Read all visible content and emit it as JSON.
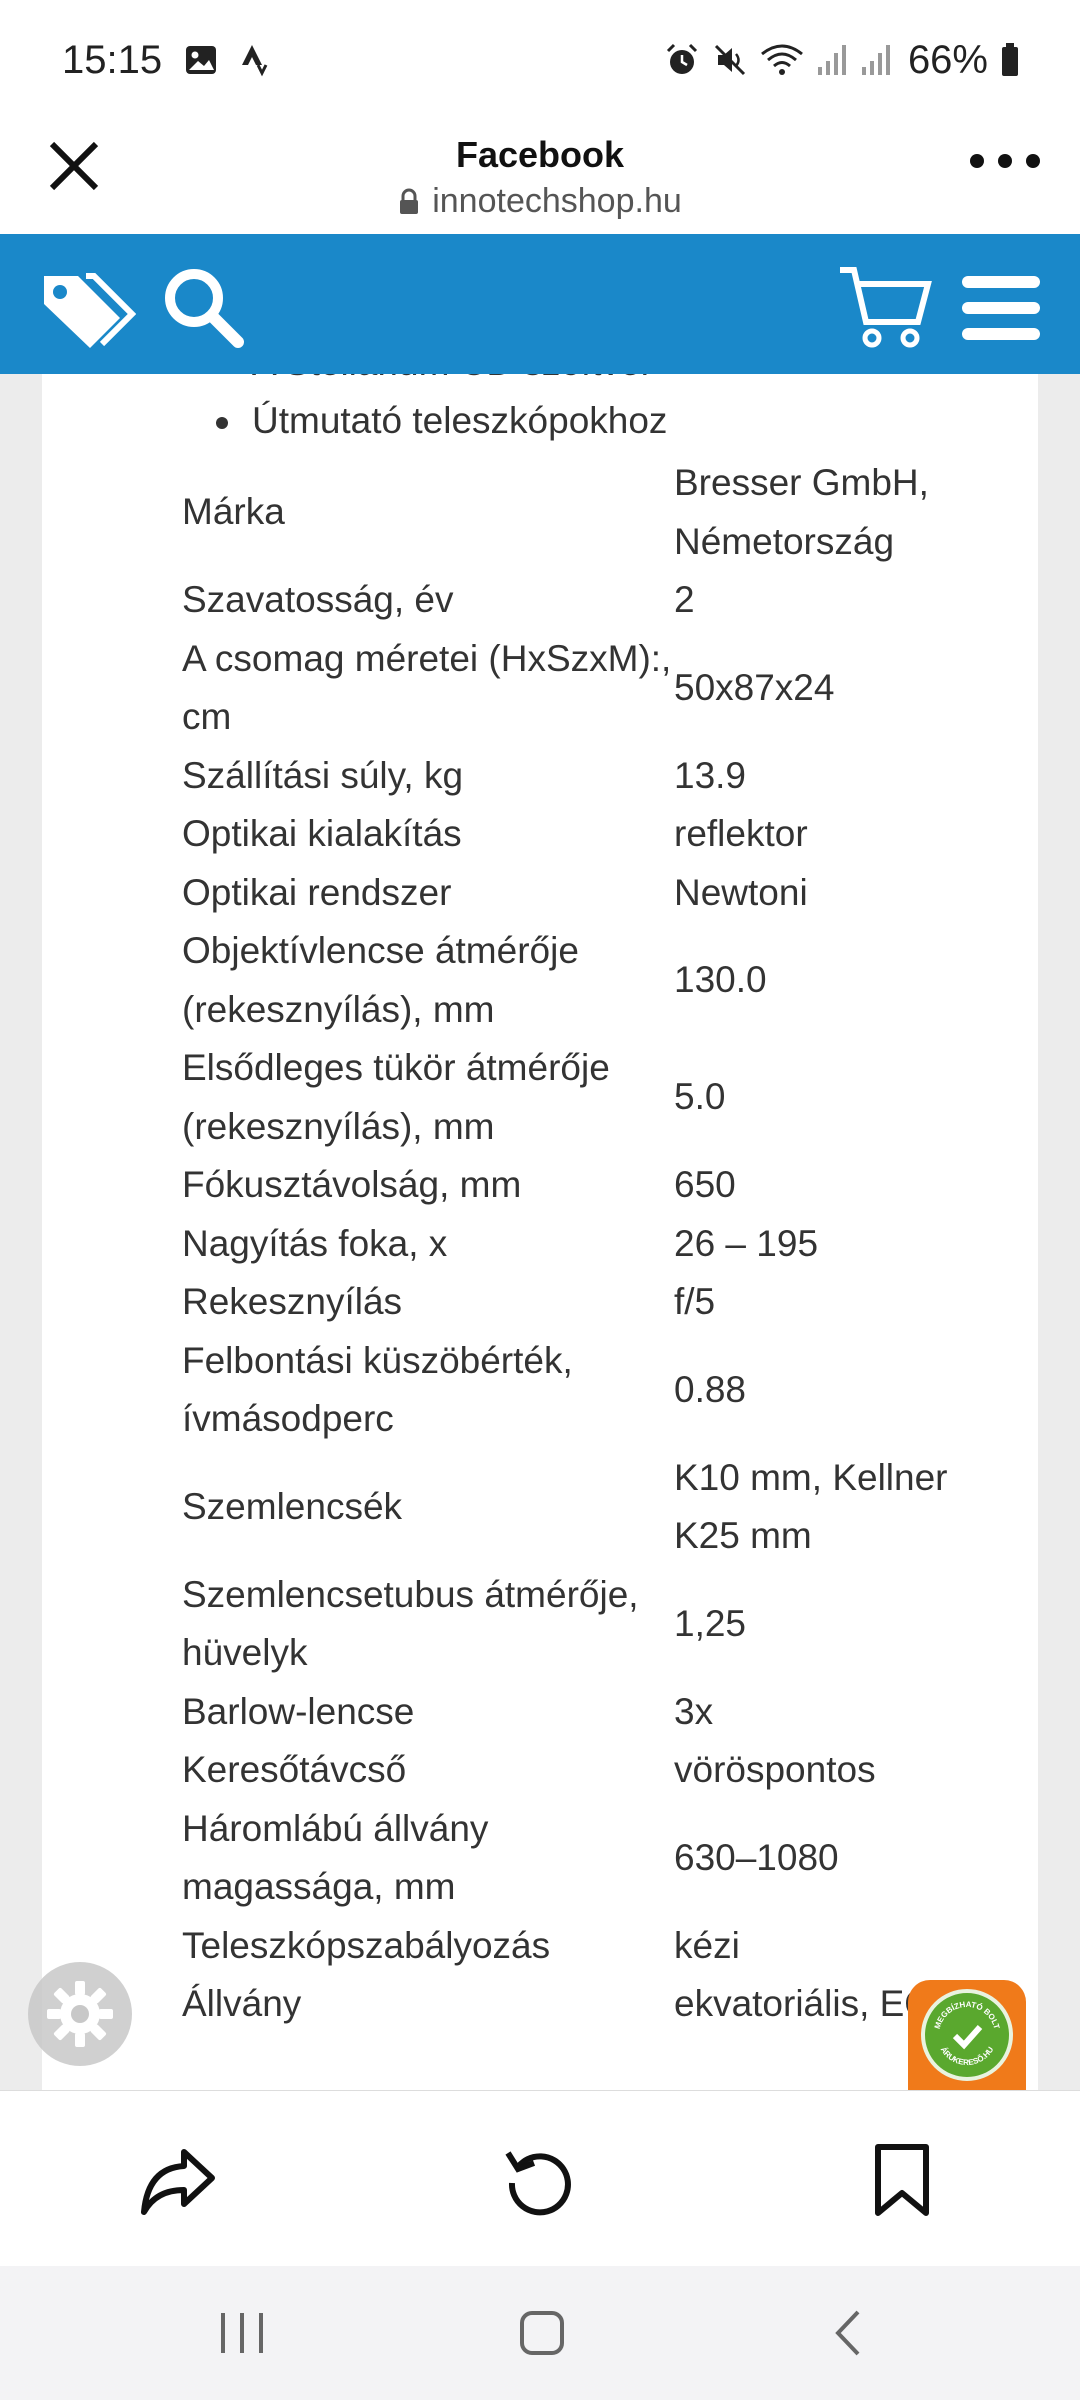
{
  "status_bar": {
    "time": "15:15",
    "battery": "66%"
  },
  "browser": {
    "title": "Facebook",
    "url": "innotechshop.hu"
  },
  "content": {
    "bullets": [
      "A Stellarium CD szoftver",
      "Útmutató teleszkópokhoz"
    ],
    "specs": [
      {
        "key": "Márka",
        "value": "Bresser GmbH, Németország"
      },
      {
        "key": "Szavatosság, év",
        "value": "2"
      },
      {
        "key": "A csomag méretei (HxSzxM):, cm",
        "value": "50x87x24"
      },
      {
        "key": "Szállítási súly, kg",
        "value": "13.9"
      },
      {
        "key": "Optikai kialakítás",
        "value": "reflektor"
      },
      {
        "key": "Optikai rendszer",
        "value": "Newtoni"
      },
      {
        "key": "Objektívlencse átmérője (rekesznyílás), mm",
        "value": "130.0"
      },
      {
        "key": "Elsődleges tükör átmérője (rekesznyílás), mm",
        "value": "5.0"
      },
      {
        "key": "Fókusztávolság, mm",
        "value": "650"
      },
      {
        "key": "Nagyítás foka, x",
        "value": "26 – 195"
      },
      {
        "key": "Rekesznyílás",
        "value": "f/5"
      },
      {
        "key": "Felbontási küszöbérték, ívmásodperc",
        "value": "0.88"
      },
      {
        "key": "Szemlencsék",
        "value": "K10 mm, Kellner K25 mm"
      },
      {
        "key": "Szemlencsetubus átmérője, hüvelyk",
        "value": "1,25"
      },
      {
        "key": "Barlow-lencse",
        "value": "3x"
      },
      {
        "key": "Keresőtávcső",
        "value": "vöröspontos"
      },
      {
        "key": "Háromlábú állvány magassága, mm",
        "value": "630–1080"
      },
      {
        "key": "Teleszkópszabályozás",
        "value": "kézi"
      },
      {
        "key": "Állvány",
        "value": "ekvatoriális, EQ"
      }
    ]
  },
  "badge": {
    "top_text": "MEGBÍZHATÓ BOLT",
    "bottom_text": "ÁRUKERESŐ.HU"
  },
  "colors": {
    "nav_blue": "#1a88c9",
    "badge_orange": "#f07a1a",
    "badge_green": "#5aa82e"
  },
  "icons": {
    "site_nav": [
      "tags-icon",
      "search-icon",
      "cart-icon",
      "menu-icon"
    ],
    "toolbar": [
      "share-icon",
      "reload-icon",
      "bookmark-icon"
    ],
    "android": [
      "recent-apps-icon",
      "home-icon",
      "back-icon"
    ]
  }
}
